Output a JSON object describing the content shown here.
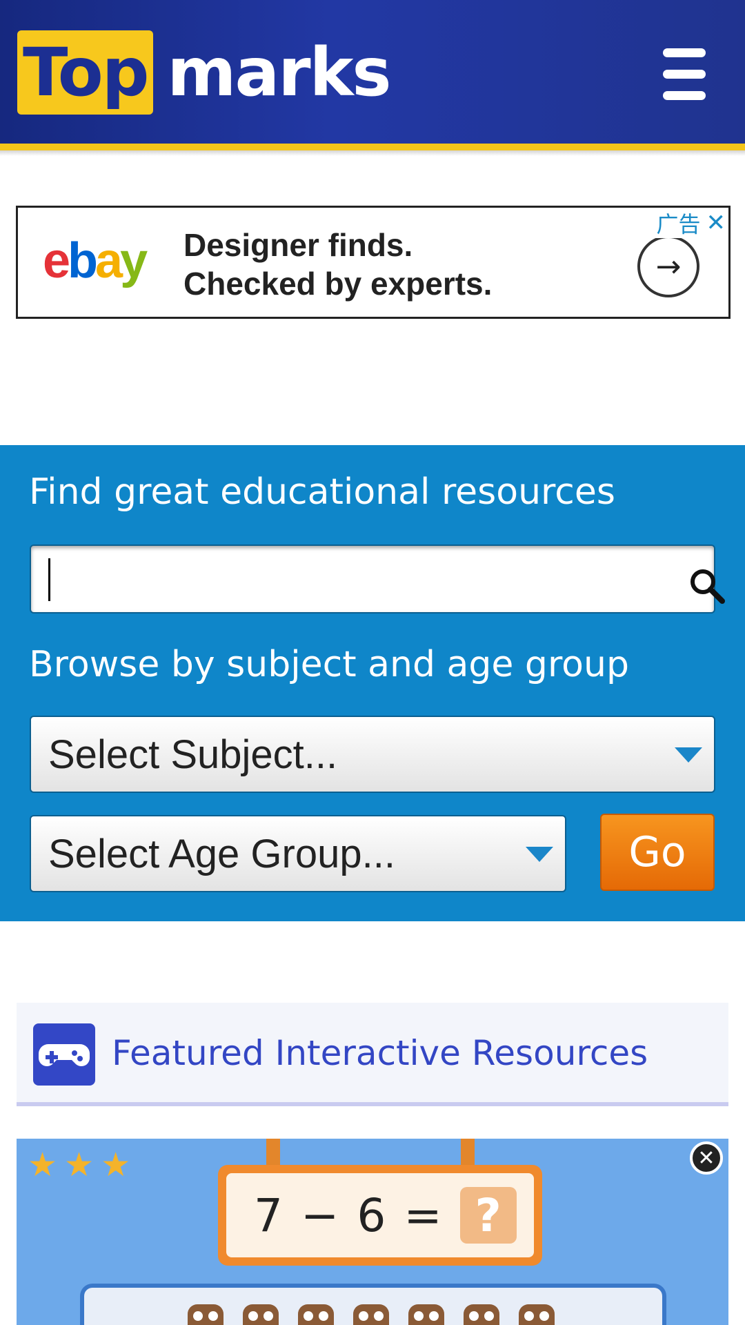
{
  "header": {
    "logo_top": "Top",
    "logo_rest": "marks",
    "menu_icon": "hamburger-menu-icon",
    "colors": {
      "header_bg": "#2238a4",
      "stripe": "#f4c51a",
      "logo_box": "#f7c81d"
    }
  },
  "ad": {
    "brand": {
      "e": "e",
      "b": "b",
      "a": "a",
      "y": "y"
    },
    "line1": "Designer finds.",
    "line2": "Checked by experts.",
    "label": "广告",
    "close": "✕",
    "arrow": "→"
  },
  "search": {
    "heading": "Find great educational resources",
    "input_value": "",
    "browse_heading": "Browse by subject and age group",
    "subject_select": "Select Subject...",
    "age_select": "Select Age Group...",
    "go_label": "Go",
    "colors": {
      "panel_bg": "#0f86c9",
      "go_button": "#f08a1c"
    }
  },
  "featured": {
    "title": "Featured Interactive Resources",
    "icon": "gamepad-icon"
  },
  "game": {
    "stars": [
      "★",
      "★",
      "★"
    ],
    "close": "✕",
    "equation": {
      "a": "7",
      "op": "−",
      "b": "6",
      "eq": "=",
      "answer": "?"
    }
  }
}
